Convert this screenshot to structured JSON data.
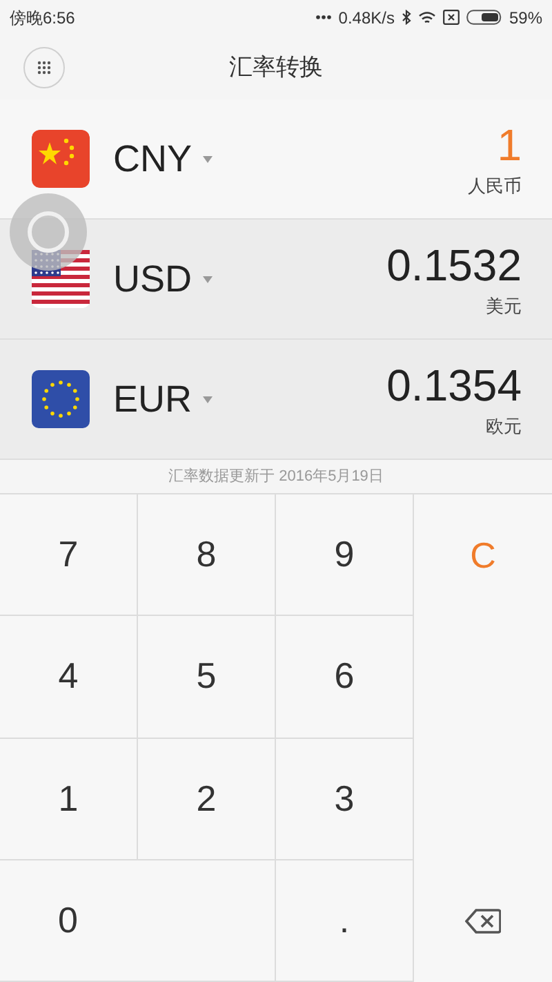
{
  "status_bar": {
    "time": "傍晚6:56",
    "network_speed": "0.48K/s",
    "battery": "59%"
  },
  "header": {
    "title": "汇率转换"
  },
  "currencies": [
    {
      "code": "CNY",
      "name": "人民币",
      "value": "1",
      "selected": true,
      "kind": "cn"
    },
    {
      "code": "USD",
      "name": "美元",
      "value": "0.1532",
      "selected": false,
      "kind": "us"
    },
    {
      "code": "EUR",
      "name": "欧元",
      "value": "0.1354",
      "selected": false,
      "kind": "eu"
    }
  ],
  "update_note": "汇率数据更新于 2016年5月19日",
  "keypad": [
    {
      "kind": "digit",
      "label": "7"
    },
    {
      "kind": "digit",
      "label": "8"
    },
    {
      "kind": "digit",
      "label": "9"
    },
    {
      "kind": "clear",
      "label": "C"
    },
    {
      "kind": "digit",
      "label": "4"
    },
    {
      "kind": "digit",
      "label": "5"
    },
    {
      "kind": "digit",
      "label": "6"
    },
    {
      "kind": "digit",
      "label": "1"
    },
    {
      "kind": "digit",
      "label": "2"
    },
    {
      "kind": "digit",
      "label": "3"
    },
    {
      "kind": "zero",
      "label": "0"
    },
    {
      "kind": "digit",
      "label": "."
    },
    {
      "kind": "backspace"
    }
  ]
}
